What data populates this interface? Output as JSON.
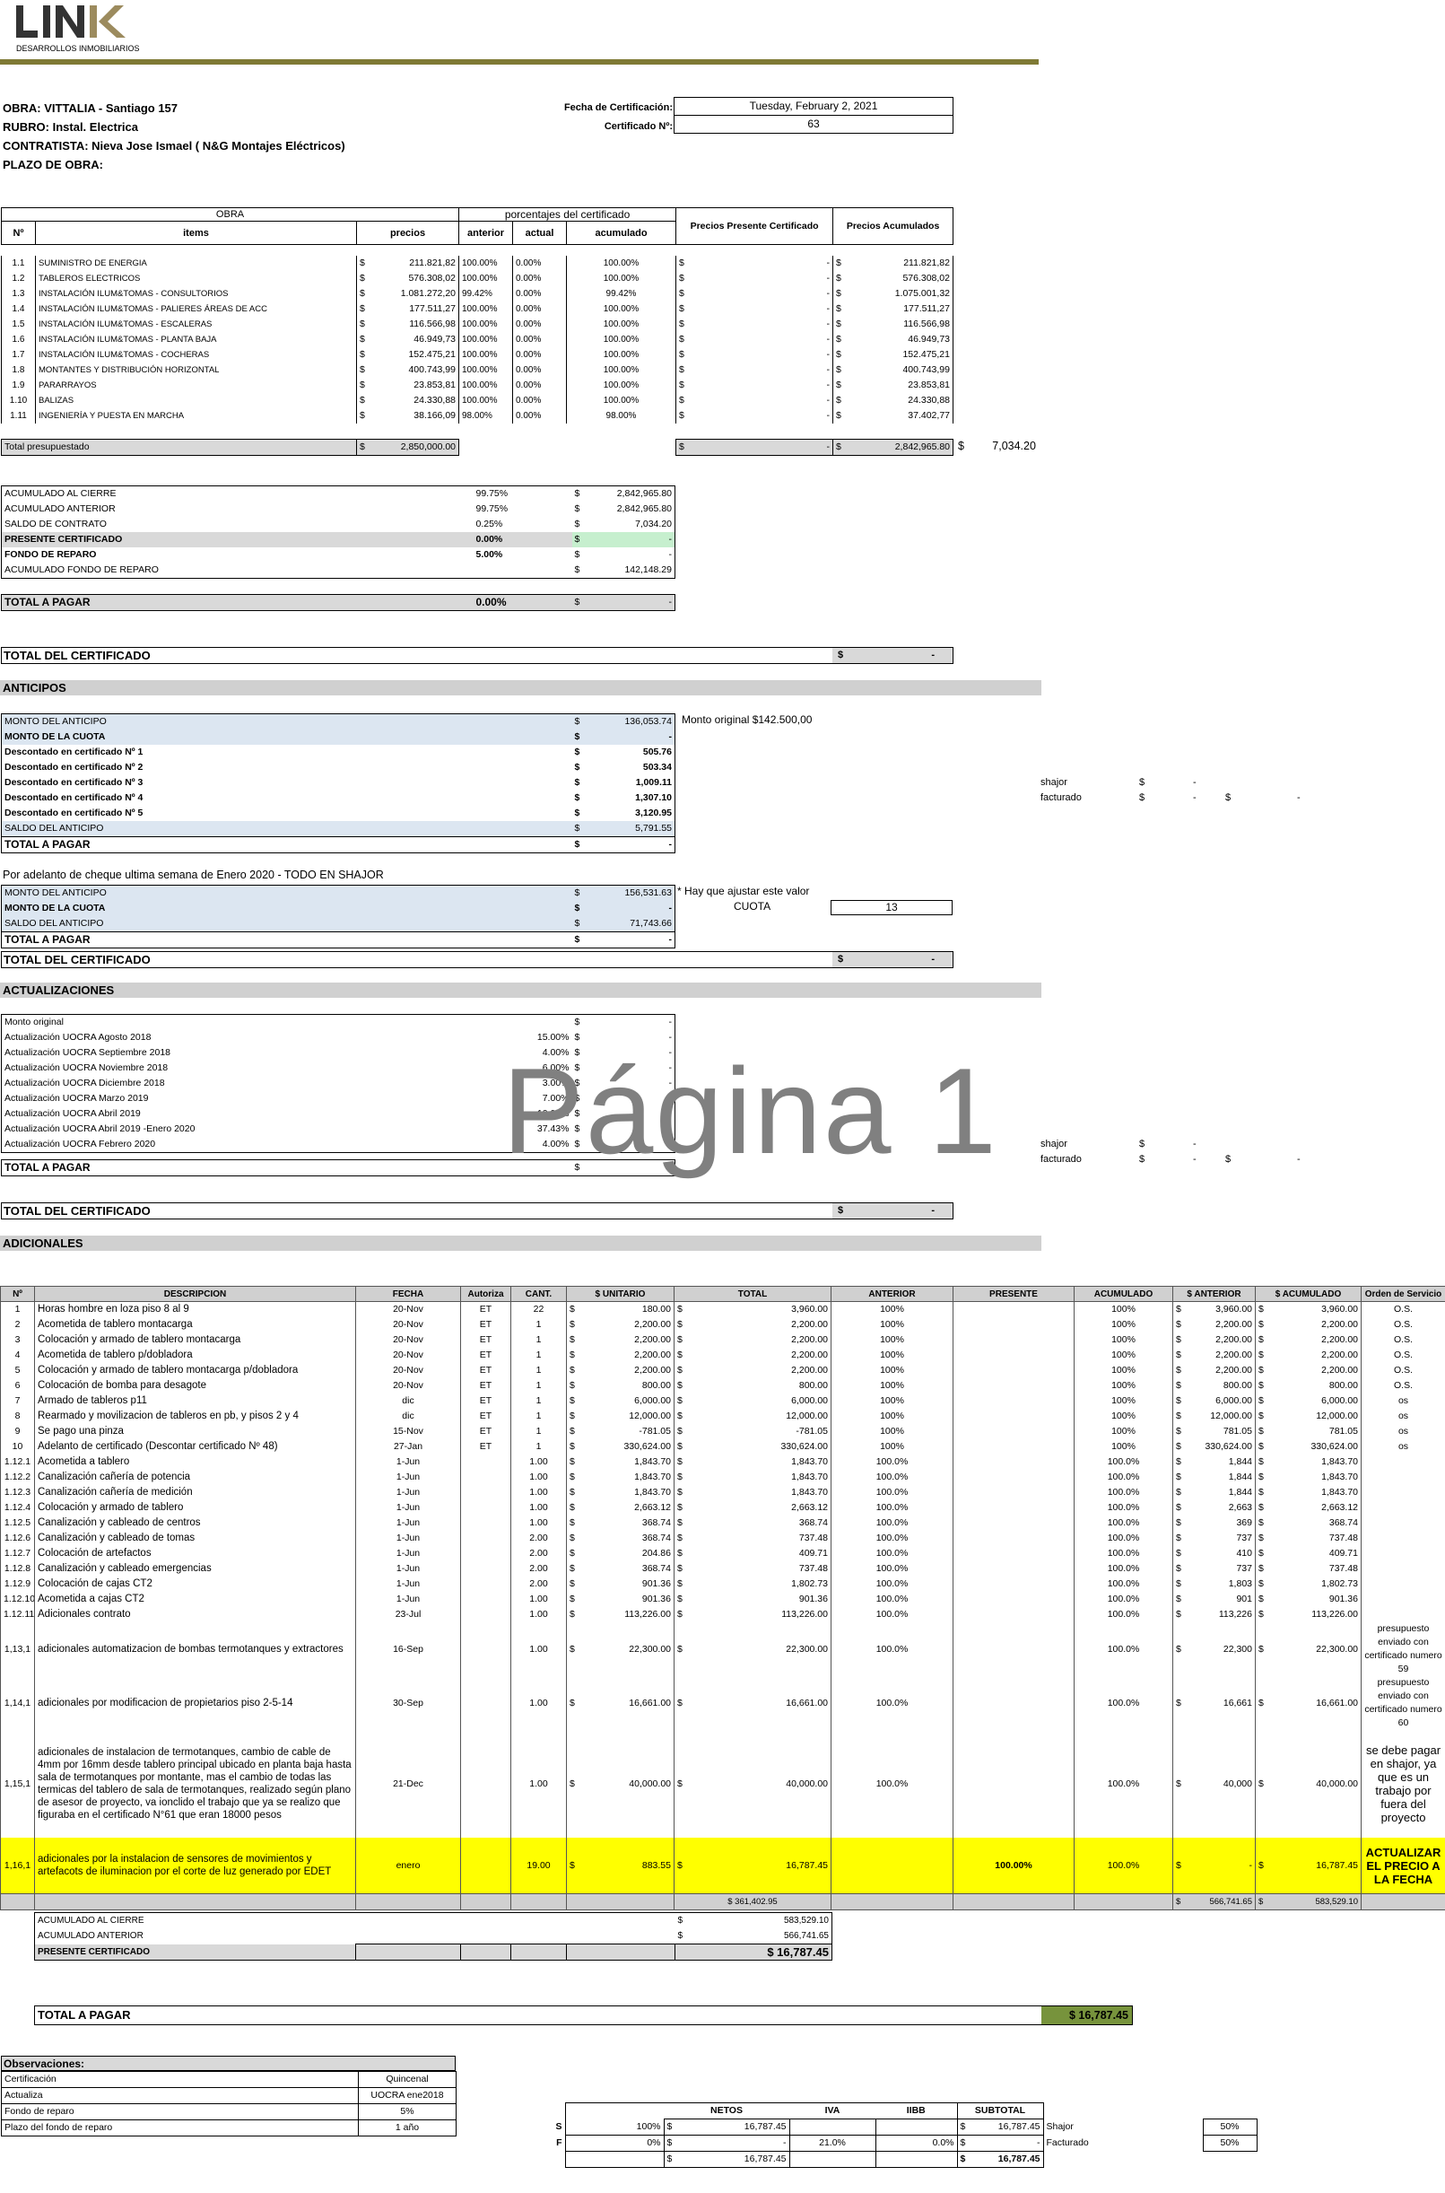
{
  "logo": {
    "name": "LINK",
    "sub": "DESARROLLOS INMOBILIARIOS"
  },
  "header": {
    "obra": "OBRA: VITTALIA - Santiago 157",
    "rubro": "RUBRO: Instal. Electrica",
    "contratista": "CONTRATISTA: Nieva Jose Ismael ( N&G Montajes Eléctricos)",
    "plazo": "PLAZO DE OBRA:",
    "fecha_label": "Fecha de Certificación:",
    "fecha_value": "Tuesday, February 2, 2021",
    "cert_label": "Certificado Nº:",
    "cert_value": "63"
  },
  "main_table": {
    "h_obra": "OBRA",
    "h_porc": "porcentajes del certificado",
    "h_n": "Nº",
    "h_items": "items",
    "h_precios": "precios",
    "h_anterior": "anterior",
    "h_actual": "actual",
    "h_acumulado": "acumulado",
    "h_presente": "Precios Presente Certificado",
    "h_acum": "Precios Acumulados",
    "rows": [
      {
        "n": "1.1",
        "item": "SUMINISTRO DE ENERGIA",
        "precio": "211.821,82",
        "ant": "100.00%",
        "act": "0.00%",
        "acu": "100.00%",
        "pres": "-",
        "pacu": "211.821,82"
      },
      {
        "n": "1.2",
        "item": "TABLEROS ELECTRICOS",
        "precio": "576.308,02",
        "ant": "100.00%",
        "act": "0.00%",
        "acu": "100.00%",
        "pres": "-",
        "pacu": "576.308,02"
      },
      {
        "n": "1.3",
        "item": "INSTALACIÓN ILUM&TOMAS - CONSULTORIOS",
        "precio": "1.081.272,20",
        "ant": "99.42%",
        "act": "0.00%",
        "acu": "99.42%",
        "pres": "-",
        "pacu": "1.075.001,32"
      },
      {
        "n": "1.4",
        "item": "INSTALACIÓN ILUM&TOMAS - PALIERES ÁREAS DE ACC",
        "precio": "177.511,27",
        "ant": "100.00%",
        "act": "0.00%",
        "acu": "100.00%",
        "pres": "-",
        "pacu": "177.511,27"
      },
      {
        "n": "1.5",
        "item": "INSTALACIÓN ILUM&TOMAS - ESCALERAS",
        "precio": "116.566,98",
        "ant": "100.00%",
        "act": "0.00%",
        "acu": "100.00%",
        "pres": "-",
        "pacu": "116.566,98"
      },
      {
        "n": "1.6",
        "item": "INSTALACIÓN ILUM&TOMAS - PLANTA BAJA",
        "precio": "46.949,73",
        "ant": "100.00%",
        "act": "0.00%",
        "acu": "100.00%",
        "pres": "-",
        "pacu": "46.949,73"
      },
      {
        "n": "1.7",
        "item": "INSTALACIÓN ILUM&TOMAS - COCHERAS",
        "precio": "152.475,21",
        "ant": "100.00%",
        "act": "0.00%",
        "acu": "100.00%",
        "pres": "-",
        "pacu": "152.475,21"
      },
      {
        "n": "1.8",
        "item": "MONTANTES Y DISTRIBUCIÓN HORIZONTAL",
        "precio": "400.743,99",
        "ant": "100.00%",
        "act": "0.00%",
        "acu": "100.00%",
        "pres": "-",
        "pacu": "400.743,99"
      },
      {
        "n": "1.9",
        "item": "PARARRAYOS",
        "precio": "23.853,81",
        "ant": "100.00%",
        "act": "0.00%",
        "acu": "100.00%",
        "pres": "-",
        "pacu": "23.853,81"
      },
      {
        "n": "1.10",
        "item": "BALIZAS",
        "precio": "24.330,88",
        "ant": "100.00%",
        "act": "0.00%",
        "acu": "100.00%",
        "pres": "-",
        "pacu": "24.330,88"
      },
      {
        "n": "1.11",
        "item": "INGENIERÍA Y PUESTA EN MARCHA",
        "precio": "38.166,09",
        "ant": "98.00%",
        "act": "0.00%",
        "acu": "98.00%",
        "pres": "-",
        "pacu": "37.402,77"
      }
    ],
    "total_label": "Total presupuestado",
    "total_precio": "2,850,000.00",
    "total_pres": "-",
    "total_acum": "2,842,965.80",
    "diff": "7,034.20"
  },
  "summary": [
    {
      "label": "ACUMULADO AL CIERRE",
      "pct": "99.75%",
      "val": "2,842,965.80",
      "bold": false
    },
    {
      "label": "ACUMULADO ANTERIOR",
      "pct": "99.75%",
      "val": "2,842,965.80",
      "bold": false
    },
    {
      "label": "SALDO DE CONTRATO",
      "pct": "0.25%",
      "val": "7,034.20",
      "bold": false
    },
    {
      "label": "PRESENTE CERTIFICADO",
      "pct": "0.00%",
      "val": "-",
      "bold": true
    },
    {
      "label": "FONDO DE REPARO",
      "pct": "5.00%",
      "val": "-",
      "bold": true
    },
    {
      "label": "ACUMULADO FONDO DE REPARO",
      "pct": "",
      "val": "142,148.29",
      "bold": false
    }
  ],
  "total_pagar": {
    "label": "TOTAL A PAGAR",
    "pct": "0.00%",
    "val": "-"
  },
  "total_cert": {
    "label": "TOTAL DEL CERTIFICADO",
    "val": "-"
  },
  "anticipos": {
    "title": "ANTICIPOS",
    "rows": [
      {
        "label": "MONTO DEL ANTICIPO",
        "val": "136,053.74",
        "bold": false,
        "blue": true
      },
      {
        "label": "MONTO DE LA CUOTA",
        "val": "-",
        "bold": true,
        "blue": true
      },
      {
        "label": "Descontado en certificado Nº 1",
        "val": "505.76",
        "bold": true,
        "blue": false
      },
      {
        "label": "Descontado en certificado Nº 2",
        "val": "503.34",
        "bold": true,
        "blue": false
      },
      {
        "label": "Descontado en certificado Nº 3",
        "val": "1,009.11",
        "bold": true,
        "blue": false
      },
      {
        "label": "Descontado en certificado Nº 4",
        "val": "1,307.10",
        "bold": true,
        "blue": false
      },
      {
        "label": "Descontado en certificado Nº 5",
        "val": "3,120.95",
        "bold": true,
        "blue": false
      },
      {
        "label": "SALDO DEL ANTICIPO",
        "val": "5,791.55",
        "bold": false,
        "blue": true
      },
      {
        "label": "TOTAL A PAGAR",
        "val": "-",
        "bold": true,
        "blue": false
      }
    ],
    "note": "Monto original $142.500,00",
    "side": {
      "shajor": "shajor",
      "facturado": "facturado"
    }
  },
  "adelanto": {
    "title": "Por adelanto de cheque ultima semana de Enero 2020 - TODO EN SHAJOR",
    "rows": [
      {
        "label": "MONTO DEL ANTICIPO",
        "val": "156,531.63",
        "bold": false,
        "blue": true
      },
      {
        "label": "MONTO DE LA CUOTA",
        "val": "-",
        "bold": true,
        "blue": true
      },
      {
        "label": "SALDO DEL ANTICIPO",
        "val": "71,743.66",
        "bold": false,
        "blue": true
      },
      {
        "label": "TOTAL A PAGAR",
        "val": "-",
        "bold": true,
        "blue": false
      }
    ],
    "note": "* Hay que ajustar este valor",
    "cuota_label": "CUOTA",
    "cuota_val": "13",
    "total_label": "TOTAL DEL CERTIFICADO",
    "total_val": "-"
  },
  "actualizaciones": {
    "title": "ACTUALIZACIONES",
    "rows": [
      {
        "label": "Monto original",
        "pct": "",
        "val": "-"
      },
      {
        "label": "Actualización UOCRA Agosto 2018",
        "pct": "15.00%",
        "val": "-"
      },
      {
        "label": "Actualización UOCRA Septiembre 2018",
        "pct": "4.00%",
        "val": "-"
      },
      {
        "label": "Actualización UOCRA Noviembre 2018",
        "pct": "6.00%",
        "val": "-"
      },
      {
        "label": "Actualización UOCRA Diciembre 2018",
        "pct": "3.00%",
        "val": "-"
      },
      {
        "label": "Actualización UOCRA Marzo 2019",
        "pct": "7.00%",
        "val": "-"
      },
      {
        "label": "Actualización UOCRA Abril 2019",
        "pct": "10.00%",
        "val": "-"
      },
      {
        "label": "Actualización UOCRA Abril 2019 -Enero 2020",
        "pct": "37.43%",
        "val": "-"
      },
      {
        "label": "Actualización UOCRA Febrero 2020",
        "pct": "4.00%",
        "val": "-"
      }
    ],
    "total_label": "TOTAL A PAGAR",
    "total_val": "-",
    "cert_label": "TOTAL DEL CERTIFICADO",
    "cert_val": "-"
  },
  "watermark": "Página 1",
  "adicionales": {
    "title": "ADICIONALES",
    "headers": [
      "Nº",
      "DESCRIPCION",
      "FECHA",
      "Autoriza",
      "CANT.",
      "$ UNITARIO",
      "TOTAL",
      "ANTERIOR",
      "PRESENTE",
      "ACUMULADO",
      "$ ANTERIOR",
      "$ ACUMULADO",
      "Orden de Servicio"
    ],
    "rows": [
      {
        "n": "1",
        "d": "Horas hombre en loza piso 8 al 9",
        "f": "20-Nov",
        "a": "ET",
        "c": "22",
        "u": "180.00",
        "t": "3,960.00",
        "ant": "100%",
        "p": "",
        "acu": "100%",
        "sa": "3,960.00",
        "sacu": "3,960.00",
        "os": "O.S."
      },
      {
        "n": "2",
        "d": "Acometida de tablero montacarga",
        "f": "20-Nov",
        "a": "ET",
        "c": "1",
        "u": "2,200.00",
        "t": "2,200.00",
        "ant": "100%",
        "p": "",
        "acu": "100%",
        "sa": "2,200.00",
        "sacu": "2,200.00",
        "os": "O.S."
      },
      {
        "n": "3",
        "d": "Colocación y armado de tablero montacarga",
        "f": "20-Nov",
        "a": "ET",
        "c": "1",
        "u": "2,200.00",
        "t": "2,200.00",
        "ant": "100%",
        "p": "",
        "acu": "100%",
        "sa": "2,200.00",
        "sacu": "2,200.00",
        "os": "O.S."
      },
      {
        "n": "4",
        "d": "Acometida de tablero p/dobladora",
        "f": "20-Nov",
        "a": "ET",
        "c": "1",
        "u": "2,200.00",
        "t": "2,200.00",
        "ant": "100%",
        "p": "",
        "acu": "100%",
        "sa": "2,200.00",
        "sacu": "2,200.00",
        "os": "O.S."
      },
      {
        "n": "5",
        "d": "Colocación y armado de tablero montacarga p/dobladora",
        "f": "20-Nov",
        "a": "ET",
        "c": "1",
        "u": "2,200.00",
        "t": "2,200.00",
        "ant": "100%",
        "p": "",
        "acu": "100%",
        "sa": "2,200.00",
        "sacu": "2,200.00",
        "os": "O.S."
      },
      {
        "n": "6",
        "d": "Colocación de bomba para desagote",
        "f": "20-Nov",
        "a": "ET",
        "c": "1",
        "u": "800.00",
        "t": "800.00",
        "ant": "100%",
        "p": "",
        "acu": "100%",
        "sa": "800.00",
        "sacu": "800.00",
        "os": "O.S."
      },
      {
        "n": "7",
        "d": "Armado de tableros p11",
        "f": "dic",
        "a": "ET",
        "c": "1",
        "u": "6,000.00",
        "t": "6,000.00",
        "ant": "100%",
        "p": "",
        "acu": "100%",
        "sa": "6,000.00",
        "sacu": "6,000.00",
        "os": "os"
      },
      {
        "n": "8",
        "d": "Rearmado y movilizacion de tableros en pb, y pisos 2 y 4",
        "f": "dic",
        "a": "ET",
        "c": "1",
        "u": "12,000.00",
        "t": "12,000.00",
        "ant": "100%",
        "p": "",
        "acu": "100%",
        "sa": "12,000.00",
        "sacu": "12,000.00",
        "os": "os"
      },
      {
        "n": "9",
        "d": "Se pago una pinza",
        "f": "15-Nov",
        "a": "ET",
        "c": "1",
        "u": "-781.05",
        "t": "-781.05",
        "ant": "100%",
        "p": "",
        "acu": "100%",
        "sa": "781.05",
        "sacu": "781.05",
        "os": "os"
      },
      {
        "n": "10",
        "d": "Adelanto de certificado (Descontar certificado Nº 48)",
        "f": "27-Jan",
        "a": "ET",
        "c": "1",
        "u": "330,624.00",
        "t": "330,624.00",
        "ant": "100%",
        "p": "",
        "acu": "100%",
        "sa": "330,624.00",
        "sacu": "330,624.00",
        "os": "os"
      },
      {
        "n": "1.12.1",
        "d": "Acometida a tablero",
        "f": "1-Jun",
        "a": "",
        "c": "1.00",
        "u": "1,843.70",
        "t": "1,843.70",
        "ant": "100.0%",
        "p": "",
        "acu": "100.0%",
        "sa": "1,844",
        "sacu": "1,843.70",
        "os": ""
      },
      {
        "n": "1.12.2",
        "d": "Canalización cañería de potencia",
        "f": "1-Jun",
        "a": "",
        "c": "1.00",
        "u": "1,843.70",
        "t": "1,843.70",
        "ant": "100.0%",
        "p": "",
        "acu": "100.0%",
        "sa": "1,844",
        "sacu": "1,843.70",
        "os": ""
      },
      {
        "n": "1.12.3",
        "d": "Canalización cañería de medición",
        "f": "1-Jun",
        "a": "",
        "c": "1.00",
        "u": "1,843.70",
        "t": "1,843.70",
        "ant": "100.0%",
        "p": "",
        "acu": "100.0%",
        "sa": "1,844",
        "sacu": "1,843.70",
        "os": ""
      },
      {
        "n": "1.12.4",
        "d": "Colocación y armado de tablero",
        "f": "1-Jun",
        "a": "",
        "c": "1.00",
        "u": "2,663.12",
        "t": "2,663.12",
        "ant": "100.0%",
        "p": "",
        "acu": "100.0%",
        "sa": "2,663",
        "sacu": "2,663.12",
        "os": ""
      },
      {
        "n": "1.12.5",
        "d": "Canalización y cableado de centros",
        "f": "1-Jun",
        "a": "",
        "c": "1.00",
        "u": "368.74",
        "t": "368.74",
        "ant": "100.0%",
        "p": "",
        "acu": "100.0%",
        "sa": "369",
        "sacu": "368.74",
        "os": ""
      },
      {
        "n": "1.12.6",
        "d": "Canalización y cableado de tomas",
        "f": "1-Jun",
        "a": "",
        "c": "2.00",
        "u": "368.74",
        "t": "737.48",
        "ant": "100.0%",
        "p": "",
        "acu": "100.0%",
        "sa": "737",
        "sacu": "737.48",
        "os": ""
      },
      {
        "n": "1.12.7",
        "d": "Colocación de artefactos",
        "f": "1-Jun",
        "a": "",
        "c": "2.00",
        "u": "204.86",
        "t": "409.71",
        "ant": "100.0%",
        "p": "",
        "acu": "100.0%",
        "sa": "410",
        "sacu": "409.71",
        "os": ""
      },
      {
        "n": "1.12.8",
        "d": "Canalización y cableado emergencias",
        "f": "1-Jun",
        "a": "",
        "c": "2.00",
        "u": "368.74",
        "t": "737.48",
        "ant": "100.0%",
        "p": "",
        "acu": "100.0%",
        "sa": "737",
        "sacu": "737.48",
        "os": ""
      },
      {
        "n": "1.12.9",
        "d": "Colocación de cajas CT2",
        "f": "1-Jun",
        "a": "",
        "c": "2.00",
        "u": "901.36",
        "t": "1,802.73",
        "ant": "100.0%",
        "p": "",
        "acu": "100.0%",
        "sa": "1,803",
        "sacu": "1,802.73",
        "os": ""
      },
      {
        "n": "1.12.10",
        "d": "Acometida a cajas CT2",
        "f": "1-Jun",
        "a": "",
        "c": "1.00",
        "u": "901.36",
        "t": "901.36",
        "ant": "100.0%",
        "p": "",
        "acu": "100.0%",
        "sa": "901",
        "sacu": "901.36",
        "os": ""
      },
      {
        "n": "1.12.11",
        "d": "Adicionales contrato",
        "f": "23-Jul",
        "a": "",
        "c": "1.00",
        "u": "113,226.00",
        "t": "113,226.00",
        "ant": "100.0%",
        "p": "",
        "acu": "100.0%",
        "sa": "113,226",
        "sacu": "113,226.00",
        "os": ""
      }
    ],
    "big_rows": [
      {
        "n": "1,13,1",
        "d": "adicionales automatizacion de bombas termotanques y extractores",
        "f": "16-Sep",
        "c": "1.00",
        "u": "22,300.00",
        "t": "22,300.00",
        "ant": "100.0%",
        "p": "",
        "acu": "100.0%",
        "sa": "22,300",
        "sacu": "22,300.00",
        "os": "presupuesto enviado con certificado numero 59",
        "h": 52,
        "osbold": false
      },
      {
        "n": "1,14,1",
        "d": "adicionales por modificacion de propietarios piso 2-5-14",
        "f": "30-Sep",
        "c": "1.00",
        "u": "16,661.00",
        "t": "16,661.00",
        "ant": "100.0%",
        "p": "",
        "acu": "100.0%",
        "sa": "16,661",
        "sacu": "16,661.00",
        "os": "presupuesto enviado con certificado numero 60",
        "h": 52,
        "osbold": false
      },
      {
        "n": "1,15,1",
        "d": "adicionales de instalacion de termotanques, cambio de cable de 4mm por 16mm desde tablero principal ubicado en planta baja hasta sala de termotanques por montante, mas el cambio de todas las termicas del tablero de sala de termotanques, realizado según plano de asesor de proyecto, va ionclido el trabajo que ya se realizo que figuraba en el certificado N°61 que eran 18000 pesos",
        "f": "21-Dec",
        "c": "1.00",
        "u": "40,000.00",
        "t": "40,000.00",
        "ant": "100.0%",
        "p": "",
        "acu": "100.0%",
        "sa": "40,000",
        "sacu": "40,000.00",
        "os": "se debe pagar en shajor, ya que es un trabajo por fuera del proyecto",
        "h": 120,
        "osbold": false
      }
    ],
    "yellow_row": {
      "n": "1,16,1",
      "d": "adicionales por la instalacion de sensores de movimientos  y artefacots de iluminacion por el corte de luz generado por EDET",
      "f": "enero",
      "c": "19.00",
      "u": "883.55",
      "t": "16,787.45",
      "ant": "",
      "p": "100.00%",
      "acu": "100.0%",
      "sa": "-",
      "sacu": "16,787.45",
      "os": "ACTUALIZAR EL PRECIO A LA FECHA"
    },
    "totals": {
      "t": "$ 361,402.95",
      "sa": "566,741.65",
      "sacu": "583,529.10"
    }
  },
  "ad_summary": [
    {
      "label": "ACUMULADO AL CIERRE",
      "val": "583,529.10"
    },
    {
      "label": "ACUMULADO ANTERIOR",
      "val": "566,741.65"
    },
    {
      "label": "PRESENTE CERTIFICADO",
      "val": "$ 16,787.45"
    }
  ],
  "ad_total": {
    "label": "TOTAL A PAGAR",
    "val": "$ 16,787.45"
  },
  "observaciones": {
    "title": "Observaciones:",
    "rows": [
      {
        "k": "Certificación",
        "v": "Quincenal"
      },
      {
        "k": "Actualiza",
        "v": "UOCRA ene2018"
      },
      {
        "k": "Fondo de reparo",
        "v": "5%"
      },
      {
        "k": "Plazo del fondo de reparo",
        "v": "1 año"
      }
    ]
  },
  "split": {
    "headers": [
      "NETOS",
      "IVA",
      "IIBB",
      "SUBTOTAL"
    ],
    "rows": [
      {
        "k": "S",
        "pct": "100%",
        "neto": "16,787.45",
        "iva": "",
        "iibb": "",
        "sub": "16,787.45",
        "name": "Shajor",
        "p2": "50%"
      },
      {
        "k": "F",
        "pct": "0%",
        "neto": "-",
        "iva": "21.0%",
        "iibb": "0.0%",
        "sub": "-",
        "name": "Facturado",
        "p2": "50%"
      }
    ],
    "tot_neto": "16,787.45",
    "tot_sub": "16,787.45"
  }
}
